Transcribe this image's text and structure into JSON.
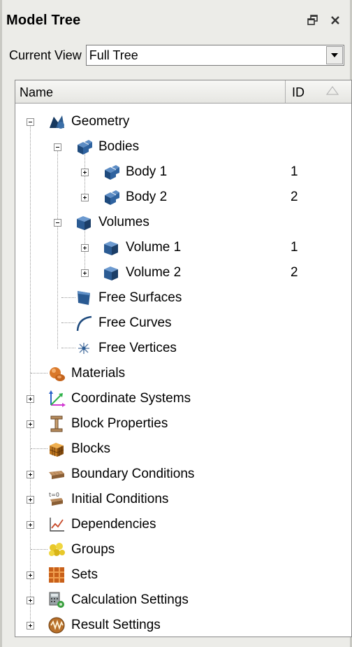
{
  "panel": {
    "title": "Model Tree",
    "float_icon": "restore-icon",
    "close_icon": "close-icon"
  },
  "view": {
    "label": "Current View",
    "value": "Full Tree"
  },
  "header": {
    "name": "Name",
    "id": "ID"
  },
  "tree": {
    "geometry": "Geometry",
    "bodies": "Bodies",
    "body1": "Body 1",
    "body1_id": "1",
    "body2": "Body 2",
    "body2_id": "2",
    "volumes": "Volumes",
    "volume1": "Volume 1",
    "volume1_id": "1",
    "volume2": "Volume 2",
    "volume2_id": "2",
    "free_surfaces": "Free Surfaces",
    "free_curves": "Free Curves",
    "free_vertices": "Free Vertices",
    "materials": "Materials",
    "coordinate_systems": "Coordinate Systems",
    "block_properties": "Block Properties",
    "blocks": "Blocks",
    "boundary_conditions": "Boundary Conditions",
    "initial_conditions": "Initial Conditions",
    "dependencies": "Dependencies",
    "groups": "Groups",
    "sets": "Sets",
    "calculation_settings": "Calculation Settings",
    "result_settings": "Result Settings"
  },
  "icons": {
    "geometry": "geometry-icon",
    "body": "body-icon",
    "volume": "volume-icon",
    "surface": "surface-icon",
    "curve": "curve-icon",
    "vertex": "vertex-icon",
    "materials": "materials-icon",
    "coordinate": "coordinate-axes-icon",
    "block_properties": "i-beam-icon",
    "blocks": "blocks-icon",
    "boundary": "boundary-icon",
    "initial": "initial-conditions-icon",
    "dependencies": "chart-icon",
    "groups": "groups-icon",
    "sets": "sets-icon",
    "calc": "calculator-icon",
    "result": "result-settings-icon"
  }
}
